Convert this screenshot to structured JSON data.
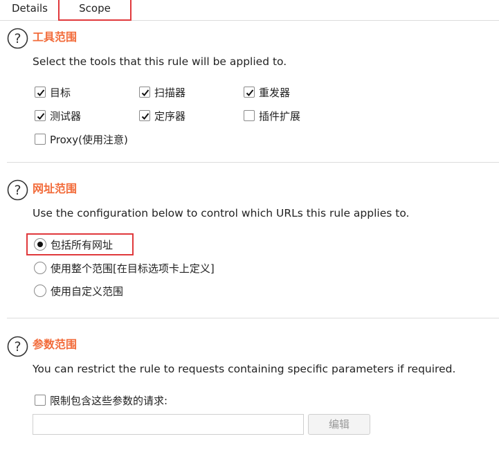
{
  "tabs": {
    "details": "Details",
    "scope": "Scope"
  },
  "tools_section": {
    "title": "工具范围",
    "description": "Select the tools that this rule will be applied to.",
    "tools": [
      {
        "label": "目标",
        "checked": true
      },
      {
        "label": "扫描器",
        "checked": true
      },
      {
        "label": "重发器",
        "checked": true
      },
      {
        "label": "测试器",
        "checked": true
      },
      {
        "label": "定序器",
        "checked": true
      },
      {
        "label": "插件扩展",
        "checked": false
      },
      {
        "label": "Proxy(使用注意)",
        "checked": false
      }
    ]
  },
  "url_section": {
    "title": "网址范围",
    "description": "Use the configuration below to control which URLs this rule applies to.",
    "options": [
      {
        "label": "包括所有网址",
        "selected": true
      },
      {
        "label": "使用整个范围[在目标选项卡上定义]",
        "selected": false
      },
      {
        "label": "使用自定义范围",
        "selected": false
      }
    ]
  },
  "params_section": {
    "title": "参数范围",
    "description": "You can restrict the rule to requests containing specific parameters if required.",
    "restrict_label": "限制包含这些参数的请求:",
    "restrict_checked": false,
    "params_value": "",
    "edit_label": "编辑"
  },
  "colors": {
    "accent": "#f26b3a",
    "highlight": "#e0383b"
  }
}
